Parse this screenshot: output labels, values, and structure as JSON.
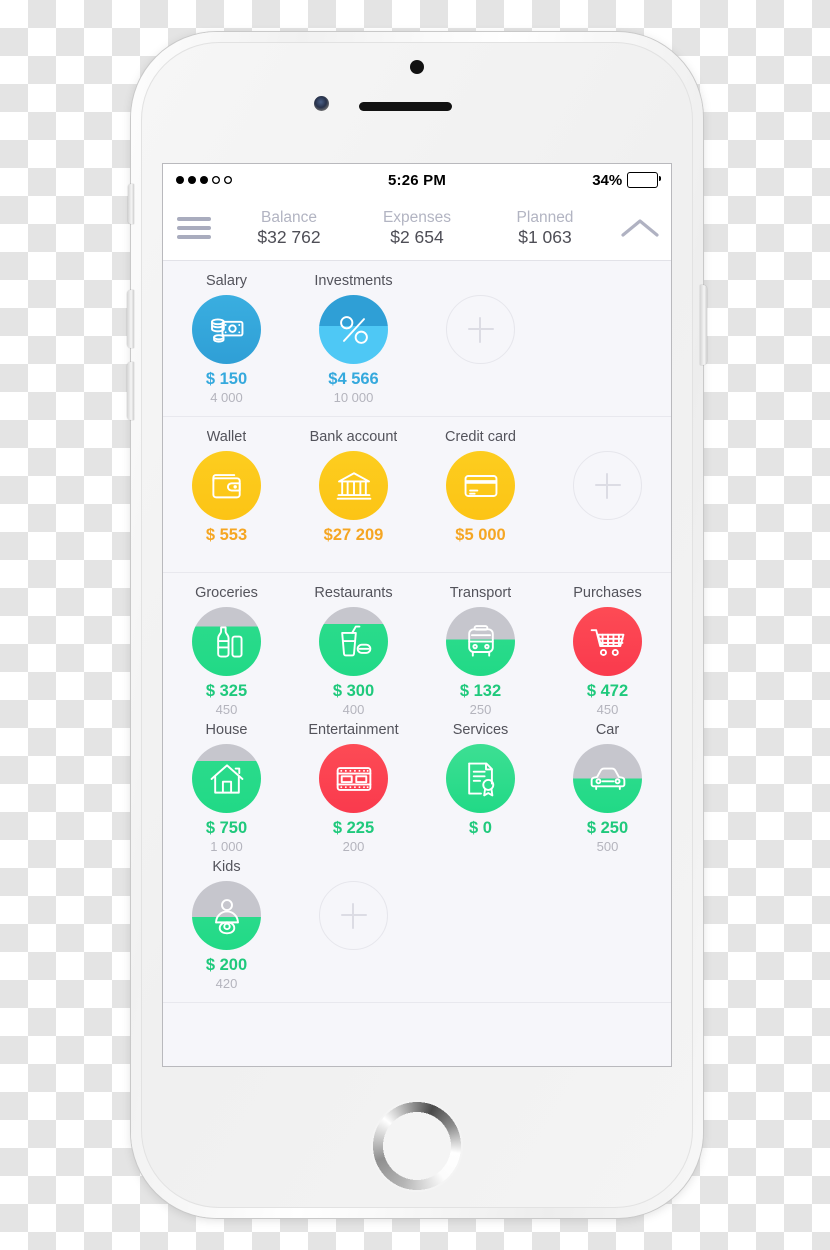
{
  "status_bar": {
    "signal_dots_filled": 3,
    "signal_dots_total": 5,
    "time": "5:26 PM",
    "battery_percent": "34%",
    "battery_level": 34
  },
  "summary": {
    "menu_icon": "hamburger-menu-icon",
    "collapse_icon": "chevron-up-icon",
    "stats": [
      {
        "label": "Balance",
        "value": "$32 762"
      },
      {
        "label": "Expenses",
        "value": "$2 654"
      },
      {
        "label": "Planned",
        "value": "$1 063"
      }
    ]
  },
  "colors": {
    "income_base": "#2f9fd6",
    "income_fill": "#4ec8f5",
    "account_yellow": "#fcc415",
    "expense_green": "#21d986",
    "expense_grey": "#c6c6cd",
    "expense_red": "#fa3a4d",
    "screen_bg": "#f6f6fa",
    "label_grey": "#b4b4bd"
  },
  "sections": [
    {
      "name": "income",
      "tiles": [
        {
          "label": "Salary",
          "amount": "$ 150",
          "budget": "4 000",
          "icon": "money-stack-icon",
          "style": "income",
          "fill_percent": 100,
          "amount_color": "#35a9dd"
        },
        {
          "label": "Investments",
          "amount": "$4 566",
          "budget": "10 000",
          "icon": "percent-icon",
          "style": "income",
          "fill_percent": 55,
          "amount_color": "#35a9dd"
        },
        {
          "label": "",
          "type": "add",
          "icon": "plus-icon"
        },
        {
          "label": "",
          "type": "empty"
        }
      ]
    },
    {
      "name": "accounts",
      "tiles": [
        {
          "label": "Wallet",
          "amount": "$ 553",
          "budget": "",
          "icon": "wallet-icon",
          "style": "account",
          "fill_percent": 100,
          "amount_color": "#f5a623"
        },
        {
          "label": "Bank account",
          "amount": "$27 209",
          "budget": "",
          "icon": "bank-icon",
          "style": "account",
          "fill_percent": 100,
          "amount_color": "#f5a623"
        },
        {
          "label": "Credit card",
          "amount": "$5 000",
          "budget": "",
          "icon": "credit-card-icon",
          "style": "account",
          "fill_percent": 100,
          "amount_color": "#f5a623"
        },
        {
          "label": "",
          "type": "add",
          "icon": "plus-icon"
        }
      ]
    },
    {
      "name": "expenses",
      "tiles": [
        {
          "label": "Groceries",
          "amount": "$ 325",
          "budget": "450",
          "icon": "bottle-icon",
          "style": "expense",
          "fill_percent": 72,
          "amount_color": "#1fc97c"
        },
        {
          "label": "Restaurants",
          "amount": "$ 300",
          "budget": "400",
          "icon": "drink-icon",
          "style": "expense",
          "fill_percent": 75,
          "amount_color": "#1fc97c"
        },
        {
          "label": "Transport",
          "amount": "$ 132",
          "budget": "250",
          "icon": "bus-icon",
          "style": "expense",
          "fill_percent": 53,
          "amount_color": "#1fc97c"
        },
        {
          "label": "Purchases",
          "amount": "$ 472",
          "budget": "450",
          "icon": "shopping-cart-icon",
          "style": "expense-over",
          "fill_percent": 100,
          "amount_color": "#1fc97c"
        },
        {
          "label": "House",
          "amount": "$ 750",
          "budget": "1 000",
          "icon": "house-icon",
          "style": "expense",
          "fill_percent": 75,
          "amount_color": "#1fc97c"
        },
        {
          "label": "Entertainment",
          "amount": "$ 225",
          "budget": "200",
          "icon": "film-icon",
          "style": "expense-over",
          "fill_percent": 100,
          "amount_color": "#1fc97c"
        },
        {
          "label": "Services",
          "amount": "$ 0",
          "budget": "",
          "icon": "certificate-icon",
          "style": "expense",
          "fill_percent": 100,
          "amount_color": "#1fc97c"
        },
        {
          "label": "Car",
          "amount": "$ 250",
          "budget": "500",
          "icon": "car-icon",
          "style": "expense",
          "fill_percent": 50,
          "amount_color": "#1fc97c"
        },
        {
          "label": "Kids",
          "amount": "$ 200",
          "budget": "420",
          "icon": "baby-icon",
          "style": "expense",
          "fill_percent": 48,
          "amount_color": "#1fc97c"
        },
        {
          "label": "",
          "type": "add",
          "icon": "plus-icon"
        },
        {
          "label": "",
          "type": "empty"
        },
        {
          "label": "",
          "type": "empty"
        }
      ]
    }
  ]
}
